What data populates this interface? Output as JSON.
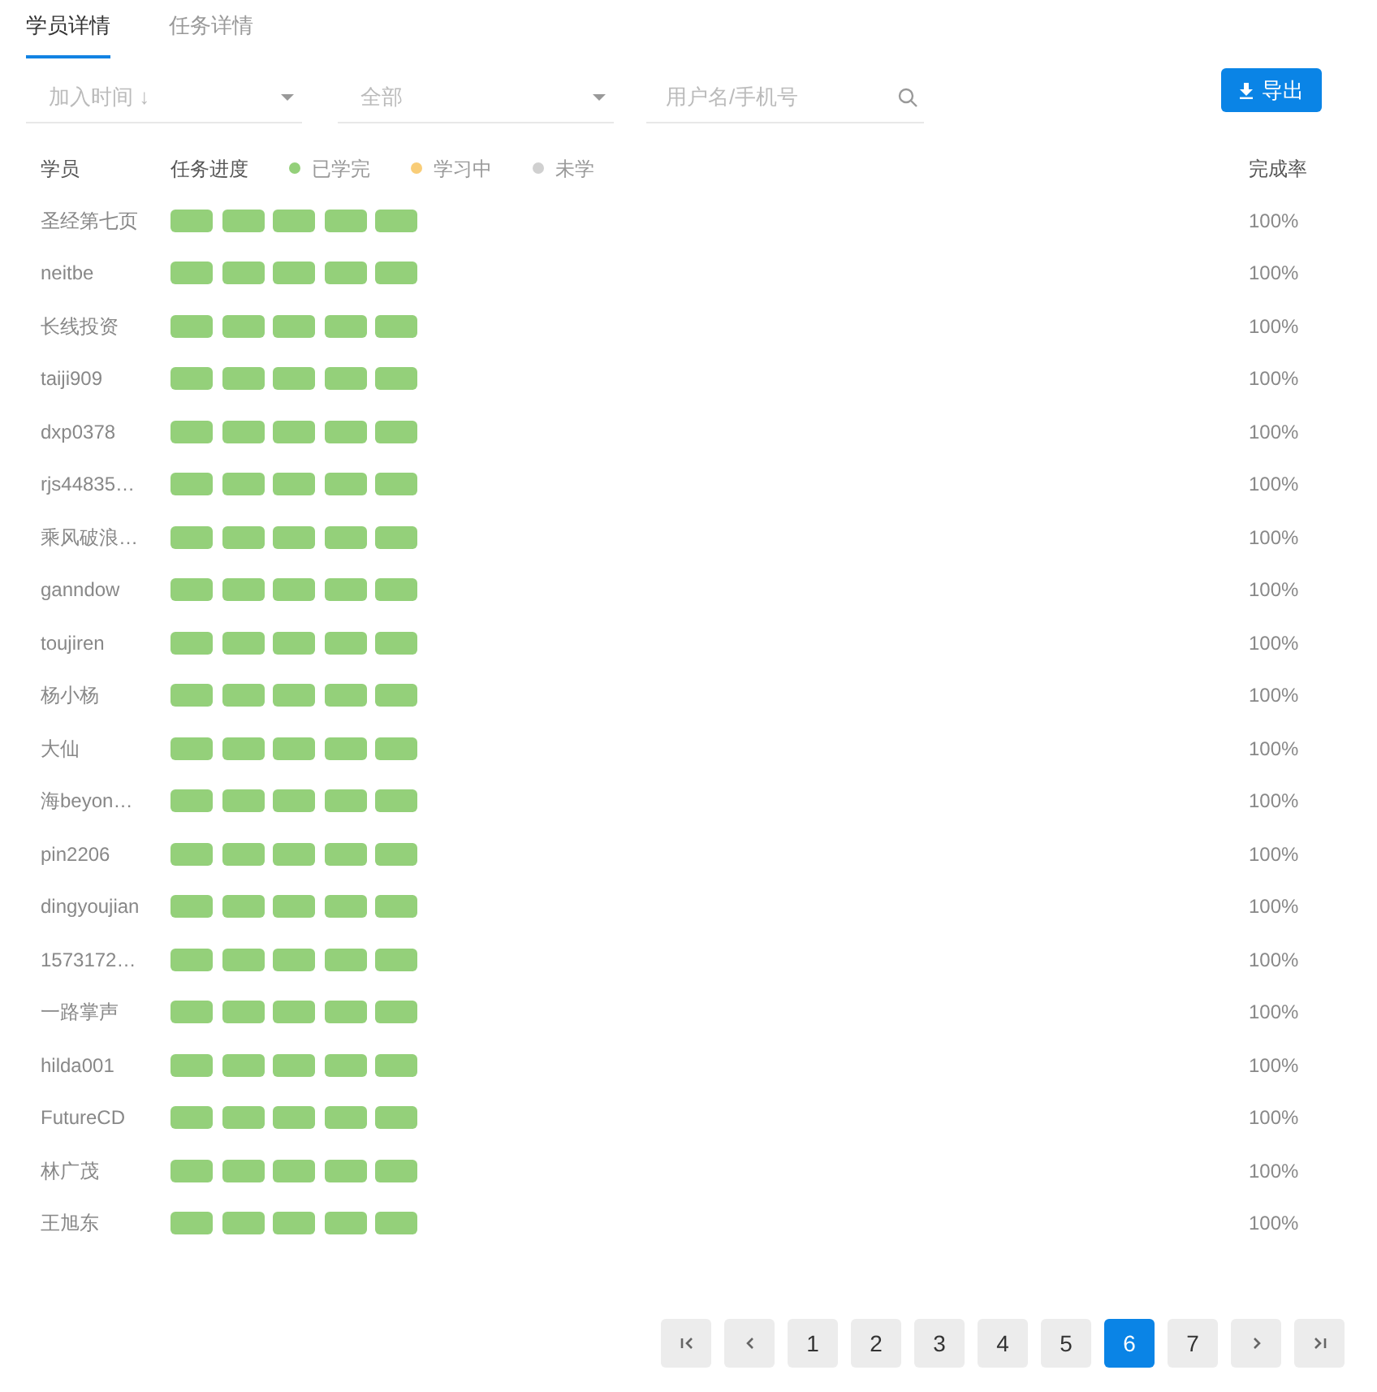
{
  "tabs": [
    {
      "label": "学员详情",
      "selected": true
    },
    {
      "label": "任务详情",
      "selected": false
    }
  ],
  "filters": {
    "sort": {
      "placeholder": "加入时间 ↓"
    },
    "scope": {
      "placeholder": "全部"
    },
    "search": {
      "placeholder": "用户名/手机号"
    }
  },
  "export_button": "导出",
  "table": {
    "columns": {
      "student": "学员",
      "progress": "任务进度",
      "rate": "完成率"
    },
    "legend": [
      {
        "label": "已学完",
        "color": "#94d07a"
      },
      {
        "label": "学习中",
        "color": "#f9cd78"
      },
      {
        "label": "未学",
        "color": "#d0d0d0"
      }
    ],
    "rows": [
      {
        "name": "圣经第七页",
        "tasks": [
          {
            "color": "#94d07a"
          },
          {
            "color": "#94d07a"
          },
          {
            "color": "#94d07a"
          },
          {
            "color": "#94d07a"
          },
          {
            "color": "#94d07a"
          }
        ],
        "rate": "100%"
      },
      {
        "name": "neitbe",
        "tasks": [
          {
            "color": "#94d07a"
          },
          {
            "color": "#94d07a"
          },
          {
            "color": "#94d07a"
          },
          {
            "color": "#94d07a"
          },
          {
            "color": "#94d07a"
          }
        ],
        "rate": "100%"
      },
      {
        "name": "长线投资",
        "tasks": [
          {
            "color": "#94d07a"
          },
          {
            "color": "#94d07a"
          },
          {
            "color": "#94d07a"
          },
          {
            "color": "#94d07a"
          },
          {
            "color": "#94d07a"
          }
        ],
        "rate": "100%"
      },
      {
        "name": "taiji909",
        "tasks": [
          {
            "color": "#94d07a"
          },
          {
            "color": "#94d07a"
          },
          {
            "color": "#94d07a"
          },
          {
            "color": "#94d07a"
          },
          {
            "color": "#94d07a"
          }
        ],
        "rate": "100%"
      },
      {
        "name": "dxp0378",
        "tasks": [
          {
            "color": "#94d07a"
          },
          {
            "color": "#94d07a"
          },
          {
            "color": "#94d07a"
          },
          {
            "color": "#94d07a"
          },
          {
            "color": "#94d07a"
          }
        ],
        "rate": "100%"
      },
      {
        "name": "rjs44835…",
        "tasks": [
          {
            "color": "#94d07a"
          },
          {
            "color": "#94d07a"
          },
          {
            "color": "#94d07a"
          },
          {
            "color": "#94d07a"
          },
          {
            "color": "#94d07a"
          }
        ],
        "rate": "100%"
      },
      {
        "name": "乘风破浪…",
        "tasks": [
          {
            "color": "#94d07a"
          },
          {
            "color": "#94d07a"
          },
          {
            "color": "#94d07a"
          },
          {
            "color": "#94d07a"
          },
          {
            "color": "#94d07a"
          }
        ],
        "rate": "100%"
      },
      {
        "name": "ganndow",
        "tasks": [
          {
            "color": "#94d07a"
          },
          {
            "color": "#94d07a"
          },
          {
            "color": "#94d07a"
          },
          {
            "color": "#94d07a"
          },
          {
            "color": "#94d07a"
          }
        ],
        "rate": "100%"
      },
      {
        "name": "toujiren",
        "tasks": [
          {
            "color": "#94d07a"
          },
          {
            "color": "#94d07a"
          },
          {
            "color": "#94d07a"
          },
          {
            "color": "#94d07a"
          },
          {
            "color": "#94d07a"
          }
        ],
        "rate": "100%"
      },
      {
        "name": "杨小杨",
        "tasks": [
          {
            "color": "#94d07a"
          },
          {
            "color": "#94d07a"
          },
          {
            "color": "#94d07a"
          },
          {
            "color": "#94d07a"
          },
          {
            "color": "#94d07a"
          }
        ],
        "rate": "100%"
      },
      {
        "name": "大仙",
        "tasks": [
          {
            "color": "#94d07a"
          },
          {
            "color": "#94d07a"
          },
          {
            "color": "#94d07a"
          },
          {
            "color": "#94d07a"
          },
          {
            "color": "#94d07a"
          }
        ],
        "rate": "100%"
      },
      {
        "name": "海beyon…",
        "tasks": [
          {
            "color": "#94d07a"
          },
          {
            "color": "#94d07a"
          },
          {
            "color": "#94d07a"
          },
          {
            "color": "#94d07a"
          },
          {
            "color": "#94d07a"
          }
        ],
        "rate": "100%"
      },
      {
        "name": "pin2206",
        "tasks": [
          {
            "color": "#94d07a"
          },
          {
            "color": "#94d07a"
          },
          {
            "color": "#94d07a"
          },
          {
            "color": "#94d07a"
          },
          {
            "color": "#94d07a"
          }
        ],
        "rate": "100%"
      },
      {
        "name": "dingyoujian",
        "tasks": [
          {
            "color": "#94d07a"
          },
          {
            "color": "#94d07a"
          },
          {
            "color": "#94d07a"
          },
          {
            "color": "#94d07a"
          },
          {
            "color": "#94d07a"
          }
        ],
        "rate": "100%"
      },
      {
        "name": "1573172…",
        "tasks": [
          {
            "color": "#94d07a"
          },
          {
            "color": "#94d07a"
          },
          {
            "color": "#94d07a"
          },
          {
            "color": "#94d07a"
          },
          {
            "color": "#94d07a"
          }
        ],
        "rate": "100%"
      },
      {
        "name": "一路掌声",
        "tasks": [
          {
            "color": "#94d07a"
          },
          {
            "color": "#94d07a"
          },
          {
            "color": "#94d07a"
          },
          {
            "color": "#94d07a"
          },
          {
            "color": "#94d07a"
          }
        ],
        "rate": "100%"
      },
      {
        "name": "hilda001",
        "tasks": [
          {
            "color": "#94d07a"
          },
          {
            "color": "#94d07a"
          },
          {
            "color": "#94d07a"
          },
          {
            "color": "#94d07a"
          },
          {
            "color": "#94d07a"
          }
        ],
        "rate": "100%"
      },
      {
        "name": "FutureCD",
        "tasks": [
          {
            "color": "#94d07a"
          },
          {
            "color": "#94d07a"
          },
          {
            "color": "#94d07a"
          },
          {
            "color": "#94d07a"
          },
          {
            "color": "#94d07a"
          }
        ],
        "rate": "100%"
      },
      {
        "name": "林广茂",
        "tasks": [
          {
            "color": "#94d07a"
          },
          {
            "color": "#94d07a"
          },
          {
            "color": "#94d07a"
          },
          {
            "color": "#94d07a"
          },
          {
            "color": "#94d07a"
          }
        ],
        "rate": "100%"
      },
      {
        "name": "王旭东",
        "tasks": [
          {
            "color": "#94d07a"
          },
          {
            "color": "#94d07a"
          },
          {
            "color": "#94d07a"
          },
          {
            "color": "#94d07a"
          },
          {
            "color": "#94d07a"
          }
        ],
        "rate": "100%"
      }
    ]
  },
  "pagination": [
    {
      "kind": "first"
    },
    {
      "kind": "prev"
    },
    {
      "kind": "page",
      "label": "1",
      "selected": false
    },
    {
      "kind": "page",
      "label": "2",
      "selected": false
    },
    {
      "kind": "page",
      "label": "3",
      "selected": false
    },
    {
      "kind": "page",
      "label": "4",
      "selected": false
    },
    {
      "kind": "page",
      "label": "5",
      "selected": false
    },
    {
      "kind": "page",
      "label": "6",
      "selected": true
    },
    {
      "kind": "page",
      "label": "7",
      "selected": false
    },
    {
      "kind": "next"
    },
    {
      "kind": "last"
    }
  ]
}
